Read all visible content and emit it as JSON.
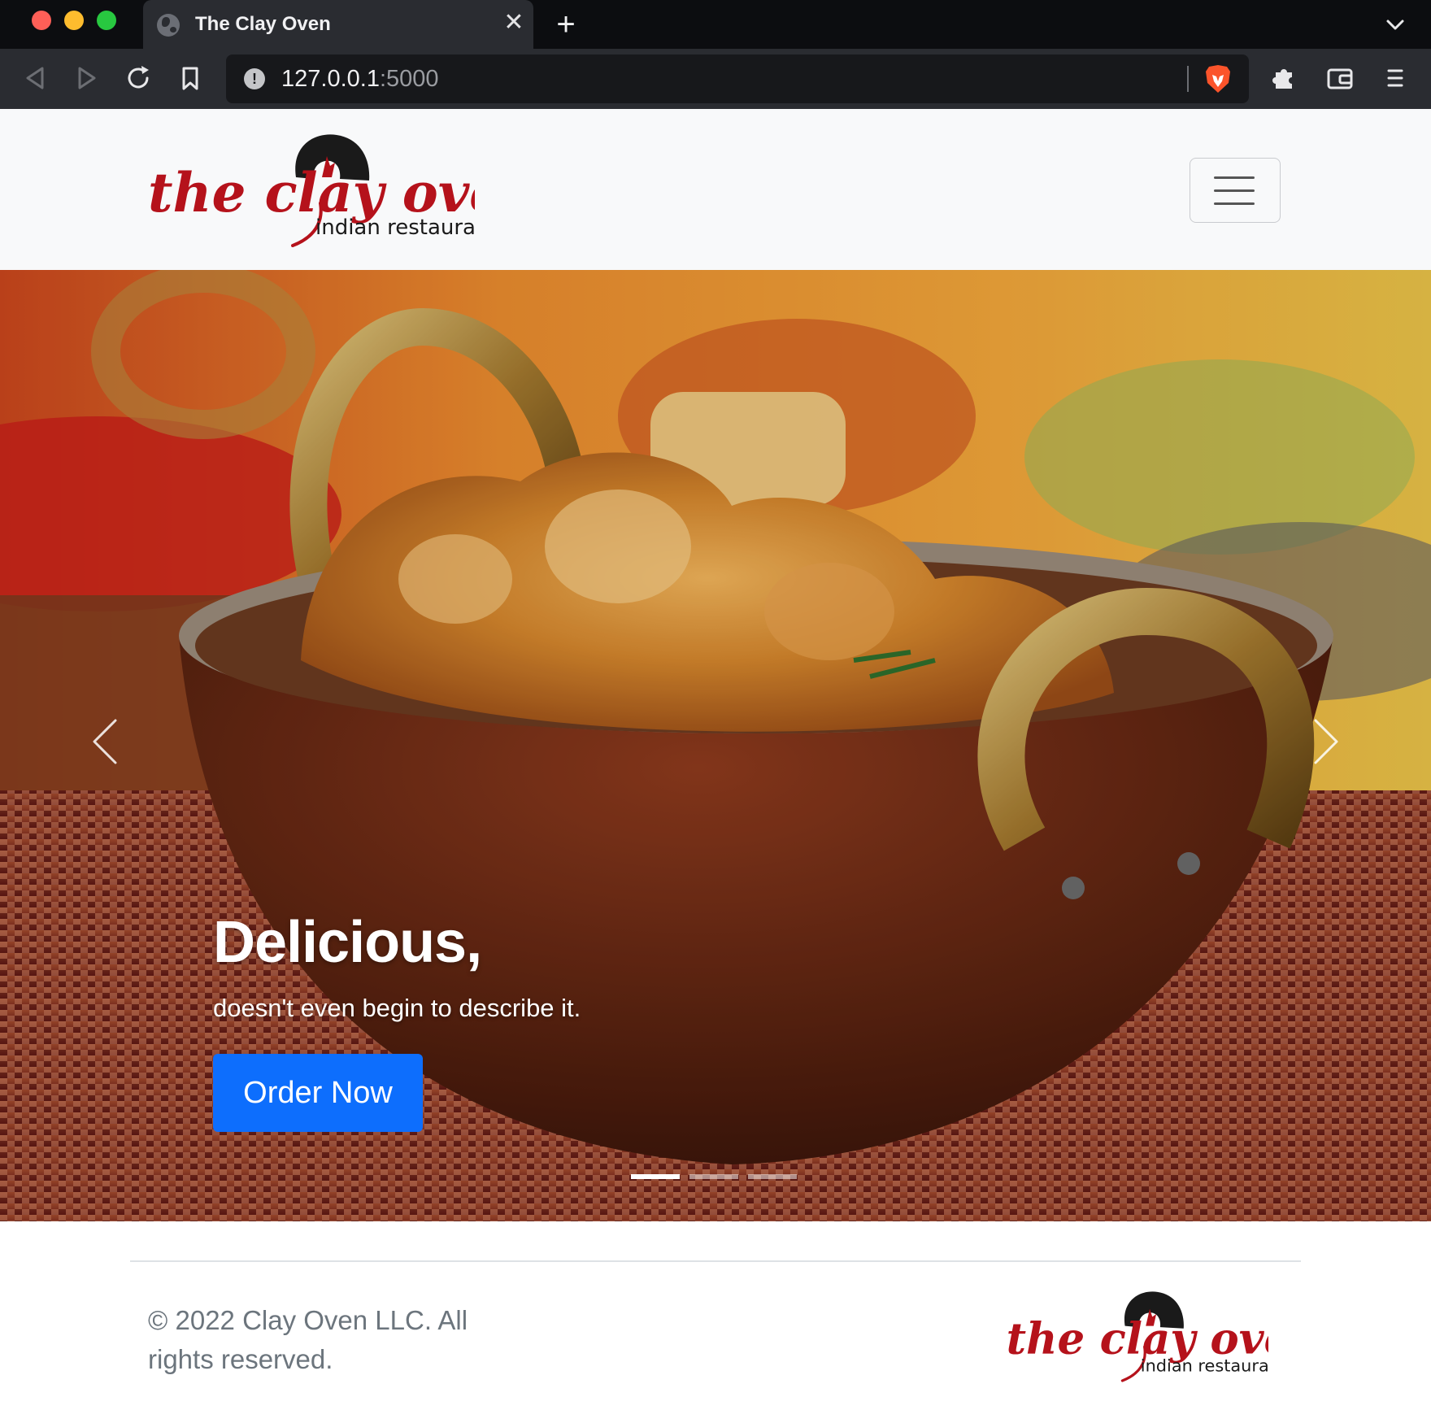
{
  "browser": {
    "tab_title": "The Clay Oven",
    "url_host": "127.0.0.1",
    "url_port": ":5000"
  },
  "navbar": {
    "logo": {
      "line1": "the clay oven",
      "line2": "indian restaurant"
    }
  },
  "hero": {
    "title": "Delicious,",
    "subtitle": "doesn't even begin to describe it.",
    "cta_label": "Order Now",
    "slide_count": 3,
    "active_slide": 1
  },
  "footer": {
    "copyright": "© 2022 Clay Oven LLC. All rights reserved.",
    "logo": {
      "line1": "the clay oven",
      "line2": "indian restaurant"
    }
  },
  "colors": {
    "brand_red": "#b5121b",
    "cta_blue": "#0d6efd",
    "navbar_bg": "#f8f9fa"
  }
}
